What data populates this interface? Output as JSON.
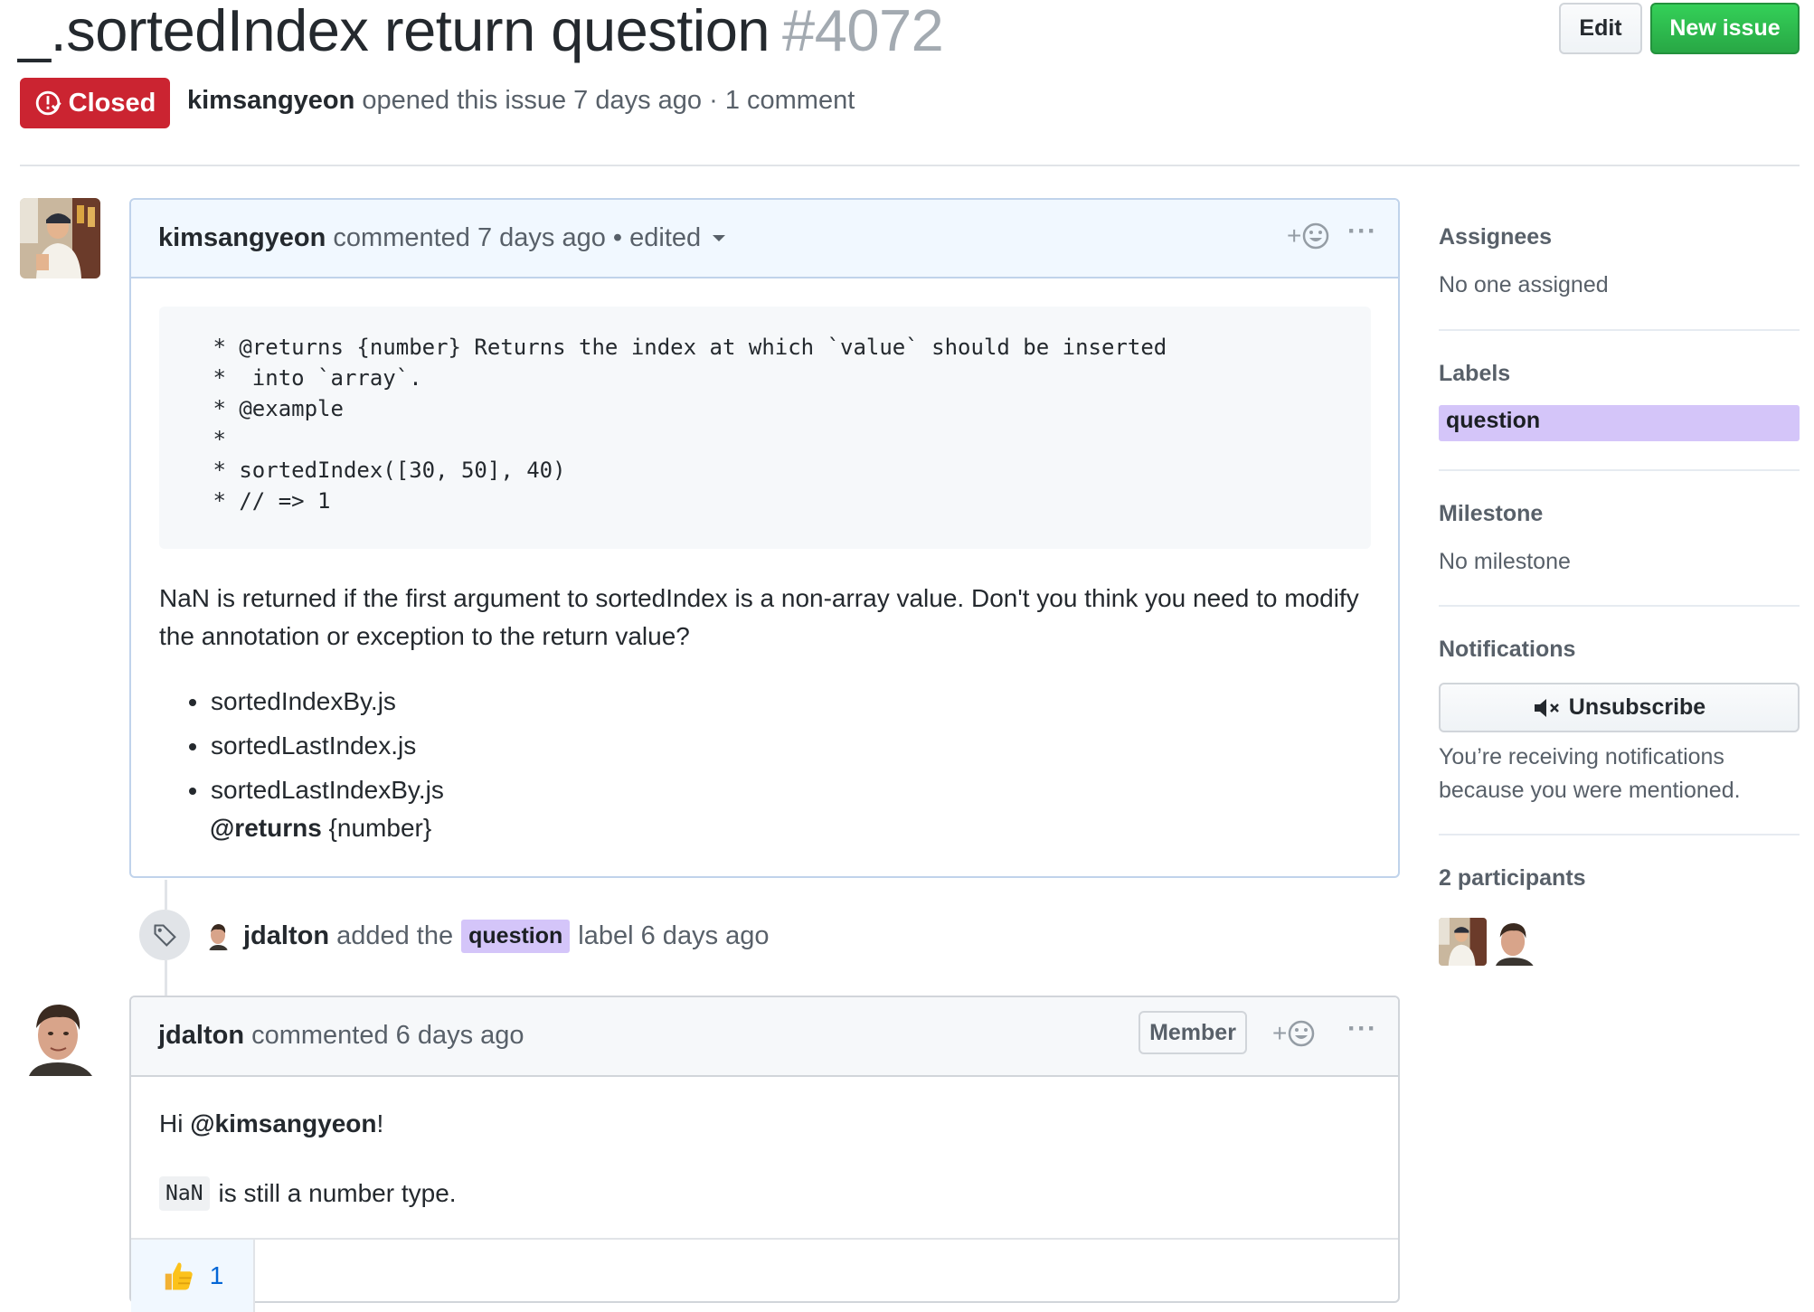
{
  "issue": {
    "title": "_.sortedIndex return question",
    "number": "#4072",
    "state": "Closed",
    "author": "kimsangyeon",
    "meta_text": "opened this issue 7 days ago · 1 comment"
  },
  "header_buttons": {
    "edit": "Edit",
    "new_issue": "New issue"
  },
  "comment1": {
    "author": "kimsangyeon",
    "meta": "commented 7 days ago • edited",
    "code": " * @returns {number} Returns the index at which `value` should be inserted\n *  into `array`.\n * @example\n *\n * sortedIndex([30, 50], 40)\n * // => 1",
    "paragraph": "NaN is returned if the first argument to sortedIndex is a non-array value. Don't you think you need to modify the annotation or exception to the return value?",
    "files": [
      "sortedIndexBy.js",
      "sortedLastIndex.js",
      "sortedLastIndexBy.js"
    ],
    "returns_bold": "@returns",
    "returns_rest": " {number}"
  },
  "event": {
    "actor": "jdalton",
    "before_label": "added the",
    "label": "question",
    "after_label": "label 6 days ago"
  },
  "comment2": {
    "author": "jdalton",
    "meta": "commented 6 days ago",
    "badge": "Member",
    "greeting_prefix": "Hi ",
    "mention": "@kimsangyeon",
    "greeting_suffix": "!",
    "code": "NaN",
    "text": "is still a number type.",
    "reaction_count": "1"
  },
  "sidebar": {
    "assignees_title": "Assignees",
    "assignees_value": "No one assigned",
    "labels_title": "Labels",
    "label": "question",
    "milestone_title": "Milestone",
    "milestone_value": "No milestone",
    "notifications_title": "Notifications",
    "unsubscribe": "Unsubscribe",
    "notif_reason": "You’re receiving notifications because you were mentioned.",
    "participants_title": "2 participants"
  },
  "colors": {
    "closed": "#cb2431",
    "new_issue": "#28a745",
    "label_question": "#d4c5f9",
    "link": "#0366d6"
  },
  "icons": [
    "issue-closed-icon",
    "add-reaction-icon",
    "more-icon",
    "dropdown-caret-icon",
    "tag-icon",
    "mute-icon",
    "thumbs-up-icon"
  ]
}
